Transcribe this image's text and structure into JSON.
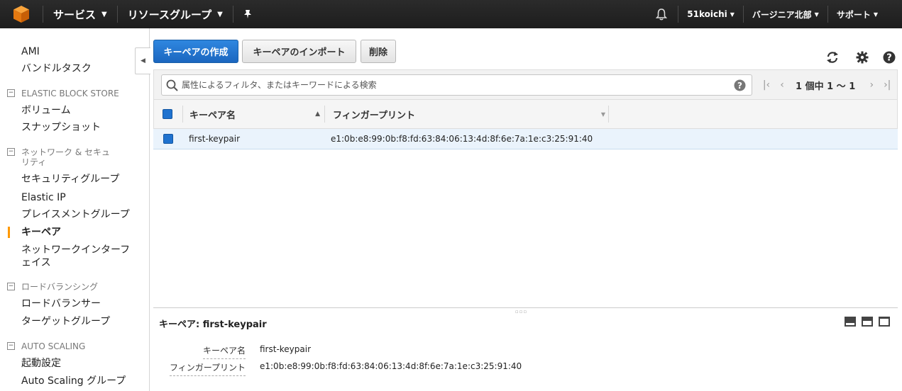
{
  "topbar": {
    "services": "サービス",
    "resource_groups": "リソースグループ",
    "user": "51koichi",
    "region": "バージニア北部",
    "support": "サポート"
  },
  "sidebar": {
    "items_top": [
      "AMI",
      "バンドルタスク"
    ],
    "section_ebs": "ELASTIC BLOCK STORE",
    "ebs_items": [
      "ボリューム",
      "スナップショット"
    ],
    "section_network": "ネットワーク & セキュリティ",
    "network_items": [
      "セキュリティグループ",
      "Elastic IP",
      "プレイスメントグループ",
      "キーペア",
      "ネットワークインターフェイス"
    ],
    "section_lb": "ロードバランシング",
    "lb_items": [
      "ロードバランサー",
      "ターゲットグループ"
    ],
    "section_as": "AUTO SCALING",
    "as_items": [
      "起動設定",
      "Auto Scaling グループ"
    ]
  },
  "toolbar": {
    "create_label": "キーペアの作成",
    "import_label": "キーペアのインポート",
    "delete_label": "削除"
  },
  "filter": {
    "placeholder": "属性によるフィルタ、またはキーワードによる検索"
  },
  "pager": {
    "text": "1 個中 1 〜 1"
  },
  "table": {
    "columns": [
      "キーペア名",
      "フィンガープリント"
    ],
    "rows": [
      {
        "name": "first-keypair",
        "fingerprint": "e1:0b:e8:99:0b:f8:fd:63:84:06:13:4d:8f:6e:7a:1e:c3:25:91:40"
      }
    ]
  },
  "detail": {
    "title": "キーペア: first-keypair",
    "fields": [
      {
        "label": "キーペア名",
        "value": "first-keypair"
      },
      {
        "label": "フィンガープリント",
        "value": "e1:0b:e8:99:0b:f8:fd:63:84:06:13:4d:8f:6e:7a:1e:c3:25:91:40"
      }
    ]
  },
  "colors": {
    "topbar": "#1d1d1d",
    "primary": "#1f72cf",
    "active_marker": "#ff9900",
    "selected_row": "#eaf3fc"
  }
}
